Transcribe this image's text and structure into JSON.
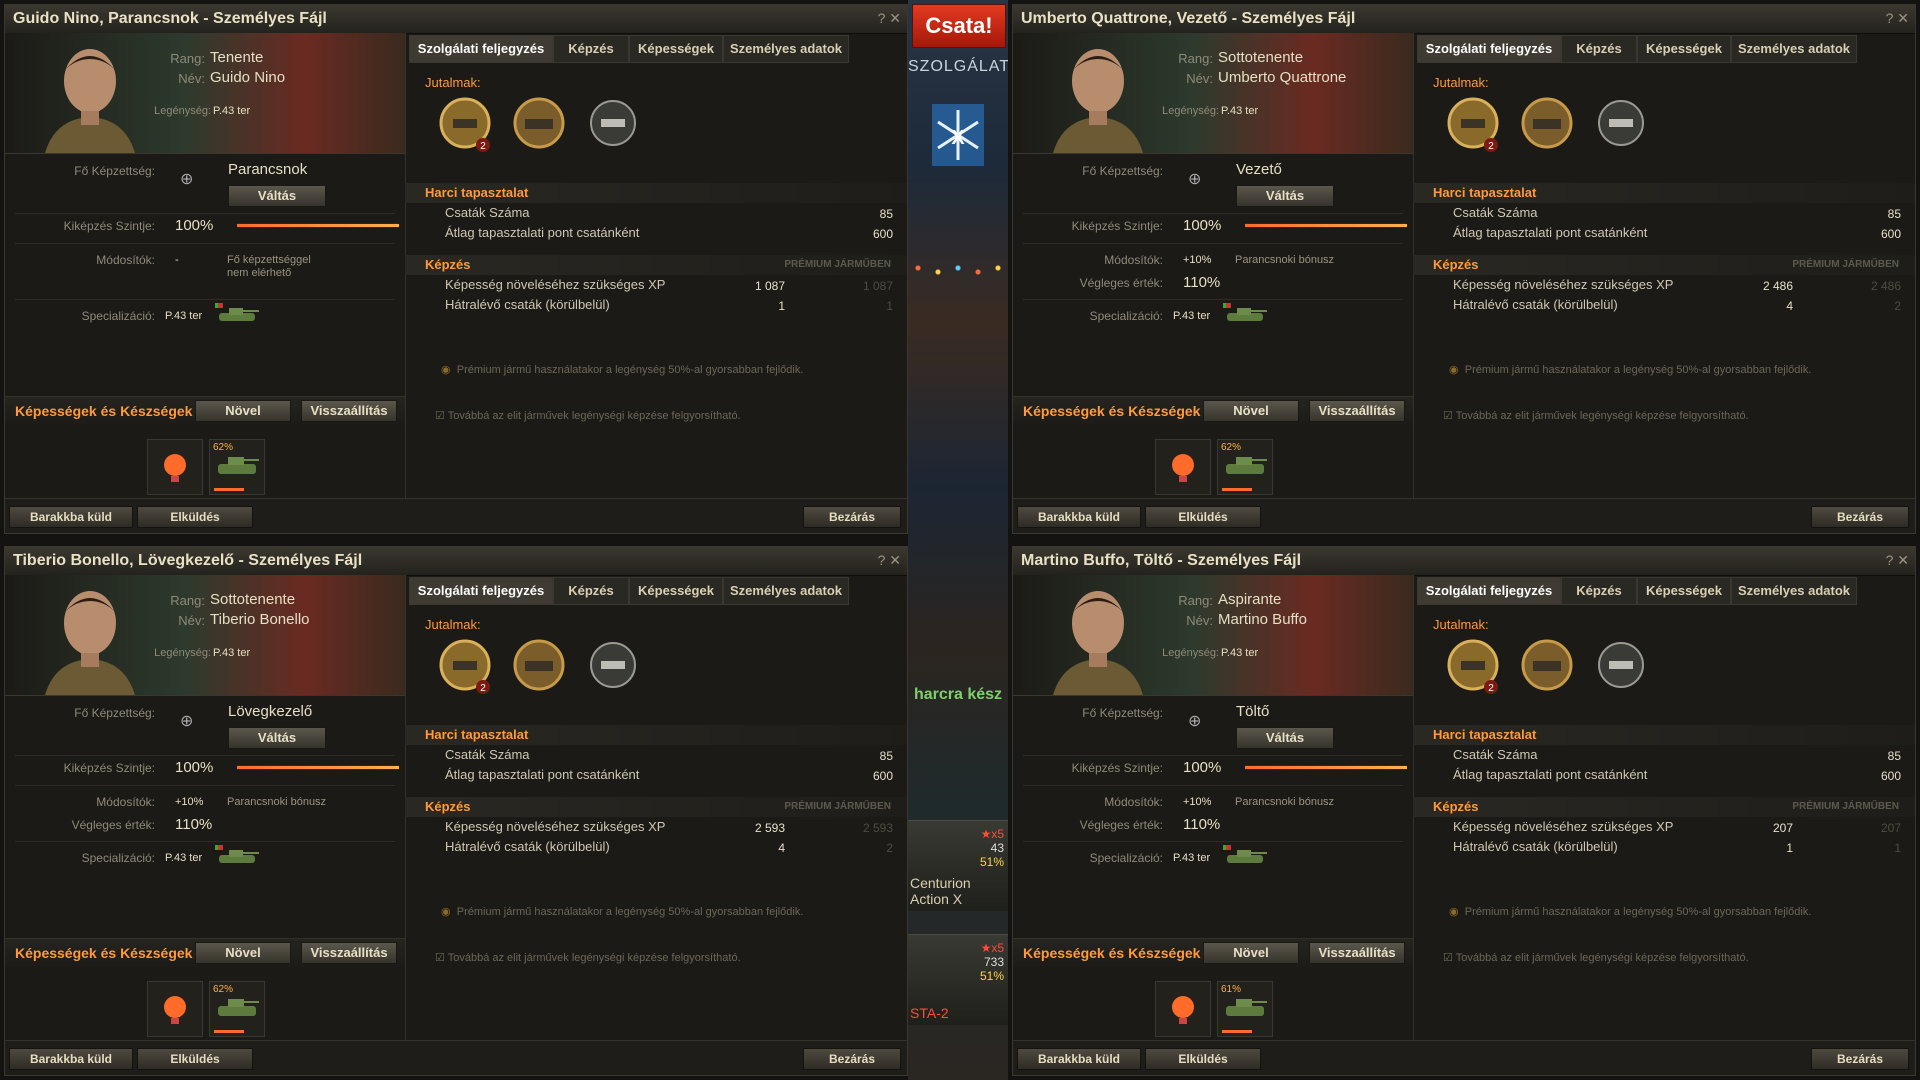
{
  "center": {
    "battle_label": "Csata!",
    "service_label": "SZOLGÁLAT",
    "ready_text": "harcra kész",
    "vehicle1": {
      "name": "Centurion Action X",
      "stars": "★x5",
      "stat1": "43",
      "stat2": "51%"
    },
    "vehicle2": {
      "name": "STA-2",
      "stars": "★x5",
      "stat1": "733",
      "stat2": "51%"
    }
  },
  "labels": {
    "rank": "Rang:",
    "name": "Név:",
    "crew": "Legénység:",
    "qualification": "Fő Képzettség:",
    "switch": "Váltás",
    "training_level": "Kiképzés Szintje:",
    "modifiers": "Módosítók:",
    "final_value": "Végleges érték:",
    "specialization": "Specializáció:",
    "skills_header": "Képességek és Készségek",
    "increase": "Növel",
    "reset": "Visszaállítás",
    "tabs": [
      "Szolgálati feljegyzés",
      "Képzés",
      "Képességek",
      "Személyes adatok"
    ],
    "awards": "Jutalmak:",
    "combat_exp": "Harci tapasztalat",
    "battles": "Csaták Száma",
    "avg_xp": "Átlag tapasztalati pont csatánként",
    "training": "Képzés",
    "premium_vehicle": "PRÉMIUM JÁRMŰBEN",
    "xp_needed": "Képesség növeléséhez szükséges XP",
    "battles_left": "Hátralévő csaták (körülbelül)",
    "note_premium": "Prémium jármű használatakor a legénység 50%-al gyorsabban fejlődik.",
    "note_elite": "Továbbá az elit járművek legénységi képzése felgyorsítható.",
    "to_barracks": "Barakkba küld",
    "dismiss": "Elküldés",
    "close": "Bezárás"
  },
  "panels": [
    {
      "title": "Guido Nino, Parancsnok - Személyes Fájl",
      "rank": "Tenente",
      "name": "Guido Nino",
      "crew_vehicle": "P.43 ter",
      "role": "Parancsnok",
      "training_pct": "100%",
      "modifier": "-",
      "modifier_note": "Fő képzettséggel nem elérhető",
      "final": "",
      "spec_vehicle": "P.43 ter",
      "battles": "85",
      "avg_xp": "600",
      "xp_needed": "1 087",
      "xp_needed_prem": "1 087",
      "battles_left": "1",
      "battles_left_prem": "1",
      "skill_pct": "62%"
    },
    {
      "title": "Umberto Quattrone, Vezető - Személyes Fájl",
      "rank": "Sottotenente",
      "name": "Umberto Quattrone",
      "crew_vehicle": "P.43 ter",
      "role": "Vezető",
      "training_pct": "100%",
      "modifier": "+10%",
      "modifier_note": "Parancsnoki bónusz",
      "final": "110%",
      "spec_vehicle": "P.43 ter",
      "battles": "85",
      "avg_xp": "600",
      "xp_needed": "2 486",
      "xp_needed_prem": "2 486",
      "battles_left": "4",
      "battles_left_prem": "2",
      "skill_pct": "62%"
    },
    {
      "title": "Tiberio Bonello, Lövegkezelő - Személyes Fájl",
      "rank": "Sottotenente",
      "name": "Tiberio Bonello",
      "crew_vehicle": "P.43 ter",
      "role": "Lövegkezelő",
      "training_pct": "100%",
      "modifier": "+10%",
      "modifier_note": "Parancsnoki bónusz",
      "final": "110%",
      "spec_vehicle": "P.43 ter",
      "battles": "85",
      "avg_xp": "600",
      "xp_needed": "2 593",
      "xp_needed_prem": "2 593",
      "battles_left": "4",
      "battles_left_prem": "2",
      "skill_pct": "62%"
    },
    {
      "title": "Martino Buffo, Töltő - Személyes Fájl",
      "rank": "Aspirante",
      "name": "Martino Buffo",
      "crew_vehicle": "P.43 ter",
      "role": "Töltő",
      "training_pct": "100%",
      "modifier": "+10%",
      "modifier_note": "Parancsnoki bónusz",
      "final": "110%",
      "spec_vehicle": "P.43 ter",
      "battles": "85",
      "avg_xp": "600",
      "xp_needed": "207",
      "xp_needed_prem": "207",
      "battles_left": "1",
      "battles_left_prem": "1",
      "skill_pct": "61%"
    }
  ]
}
